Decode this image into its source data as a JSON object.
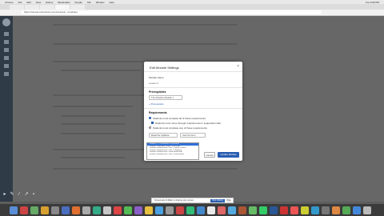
{
  "menubar": {
    "items": [
      "Chrome",
      "File",
      "Edit",
      "View",
      "History",
      "Bookmarks",
      "People",
      "Tab",
      "Window",
      "Help"
    ],
    "clock": "Tue 6:06 PM"
  },
  "browser": {
    "url": "https://canvas.instructure.com/courses/.../modules"
  },
  "modal": {
    "title": "Edit Module Settings",
    "close": "×",
    "name_label": "Module Name",
    "name_value": "Lesson 1",
    "prerequisites_label": "Prerequisites",
    "prereq_select": "The Practice Module 1",
    "add_prereq": "+ Prerequisite",
    "requirements_label": "Requirements",
    "req_option_all": "Students must complete all of these requirements",
    "req_sequential": "Students must move through requirements in sequential order",
    "req_option_one": "Students must complete one of these requirements",
    "requirement_item_select": "Read the Syllabus",
    "requirement_type_select": "view the item",
    "dropdown_items": [
      "Lesson 1 - Introduction Overview",
      "Lesson Overview Video: Overview",
      "Lesson Assessment: Part 1 Quick Check",
      "Lesson Assessment: Part 2 Reading",
      "Lesson Assessment: Final Reflection",
      "Lesson Assessment: Part 3 Discussion"
    ],
    "cancel": "Cancel",
    "update": "Update Module"
  },
  "toast": {
    "text": "Screencast-O-Matic is sharing your screen.",
    "stop": "Stop sharing",
    "hide": "Hide"
  },
  "colors": {
    "accent": "#2a5db0",
    "sidebar": "#2f3b46",
    "overlay": "#676767"
  },
  "toolbar_icons": [
    "cursor-icon",
    "pen-icon",
    "line-icon",
    "arrow-icon",
    "camera-icon"
  ]
}
